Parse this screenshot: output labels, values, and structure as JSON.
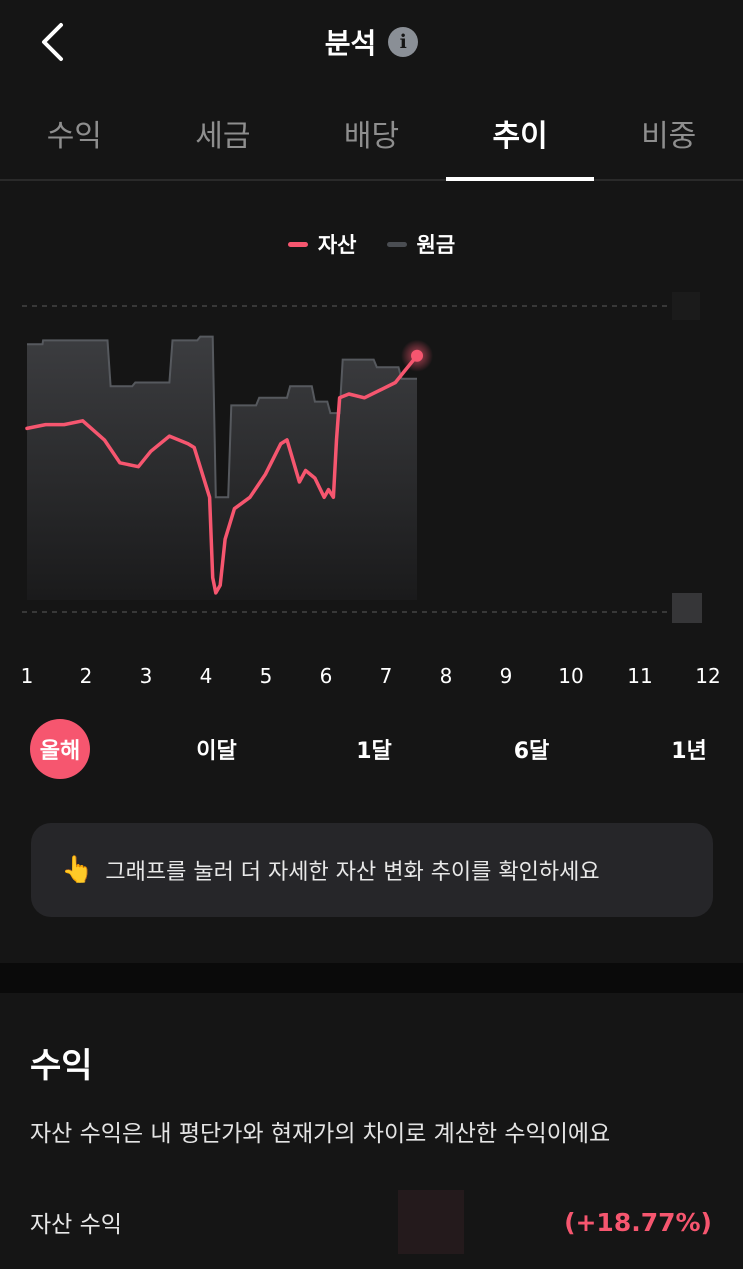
{
  "header": {
    "title": "분석",
    "info_glyph": "i"
  },
  "tabs": [
    {
      "label": "수익",
      "active": false
    },
    {
      "label": "세금",
      "active": false
    },
    {
      "label": "배당",
      "active": false
    },
    {
      "label": "추이",
      "active": true
    },
    {
      "label": "비중",
      "active": false
    }
  ],
  "legend": {
    "asset": {
      "label": "자산",
      "color": "#f6566f"
    },
    "principal": {
      "label": "원금",
      "color": "#4a4d52"
    }
  },
  "chart_data": {
    "type": "line",
    "x_ticks": [
      "1",
      "2",
      "3",
      "4",
      "5",
      "6",
      "7",
      "8",
      "9",
      "10",
      "11",
      "12"
    ],
    "series": [
      {
        "name": "자산",
        "color": "#f6566f",
        "x": [
          1.0,
          1.3,
          1.6,
          1.9,
          2.25,
          2.5,
          2.8,
          3.0,
          3.3,
          3.6,
          3.7,
          3.95,
          4.0,
          4.05,
          4.12,
          4.2,
          4.35,
          4.6,
          4.85,
          5.1,
          5.2,
          5.4,
          5.5,
          5.65,
          5.8,
          5.87,
          5.95,
          6.0,
          6.05,
          6.2,
          6.45,
          6.7,
          6.95,
          7.1,
          7.3
        ],
        "y": [
          0.73,
          0.74,
          0.74,
          0.75,
          0.7,
          0.64,
          0.63,
          0.67,
          0.71,
          0.69,
          0.68,
          0.55,
          0.34,
          0.3,
          0.32,
          0.44,
          0.52,
          0.55,
          0.61,
          0.69,
          0.7,
          0.59,
          0.62,
          0.6,
          0.55,
          0.57,
          0.55,
          0.7,
          0.81,
          0.82,
          0.81,
          0.83,
          0.85,
          0.88,
          0.92
        ]
      },
      {
        "name": "원금",
        "color": "#4a4d52",
        "x": [
          1.0,
          1.25,
          1.26,
          1.6,
          1.65,
          2.0,
          2.05,
          2.3,
          2.35,
          2.7,
          2.75,
          3.3,
          3.35,
          3.75,
          3.8,
          4.0,
          4.05,
          4.25,
          4.3,
          4.7,
          4.75,
          5.2,
          5.25,
          5.6,
          5.65,
          5.85,
          5.9,
          6.05,
          6.1,
          6.6,
          6.65,
          7.0,
          7.05,
          7.3
        ],
        "y": [
          0.95,
          0.95,
          0.96,
          0.96,
          0.96,
          0.96,
          0.96,
          0.96,
          0.84,
          0.84,
          0.85,
          0.85,
          0.96,
          0.96,
          0.97,
          0.97,
          0.55,
          0.55,
          0.79,
          0.79,
          0.81,
          0.81,
          0.84,
          0.84,
          0.8,
          0.8,
          0.77,
          0.77,
          0.91,
          0.91,
          0.89,
          0.89,
          0.86,
          0.86
        ]
      }
    ],
    "ylim": [
      0.25,
      1.05
    ],
    "xlim": [
      1,
      12
    ]
  },
  "ranges": [
    {
      "label": "올해",
      "active": true
    },
    {
      "label": "이달",
      "active": false
    },
    {
      "label": "1달",
      "active": false
    },
    {
      "label": "6달",
      "active": false
    },
    {
      "label": "1년",
      "active": false
    }
  ],
  "tip": {
    "icon": "👆",
    "text": "그래프를 눌러 더 자세한 자산 변화 추이를 확인하세요"
  },
  "profit": {
    "title": "수익",
    "desc": "자산 수익은 내 평단가와 현재가의 차이로 계산한 수익이에요",
    "row_label": "자산 수익",
    "row_value": "(+18.77%)"
  }
}
